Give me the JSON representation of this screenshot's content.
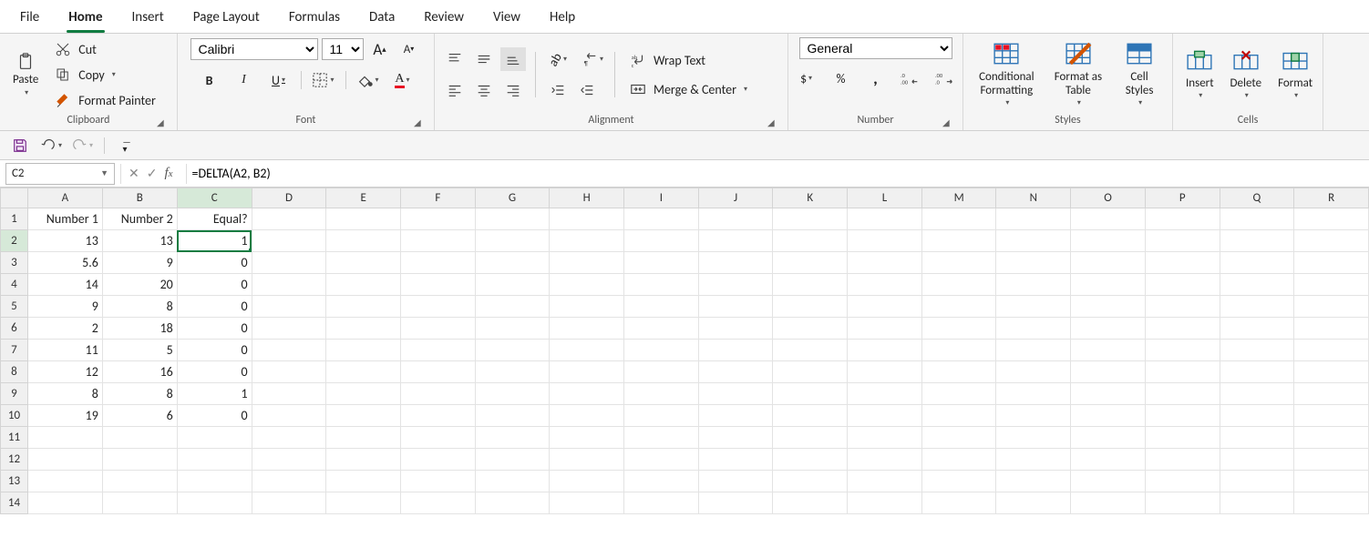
{
  "tabs": [
    "File",
    "Home",
    "Insert",
    "Page Layout",
    "Formulas",
    "Data",
    "Review",
    "View",
    "Help"
  ],
  "active_tab": "Home",
  "ribbon": {
    "clipboard": {
      "label": "Clipboard",
      "paste": "Paste",
      "cut": "Cut",
      "copy": "Copy",
      "painter": "Format Painter"
    },
    "font": {
      "label": "Font",
      "name": "Calibri",
      "size": "11",
      "grow": "A",
      "shrink": "A"
    },
    "alignment": {
      "label": "Alignment",
      "wrap": "Wrap Text",
      "merge": "Merge & Center"
    },
    "number": {
      "label": "Number",
      "format": "General"
    },
    "styles": {
      "label": "Styles",
      "cond": "Conditional Formatting",
      "table": "Format as Table",
      "cell": "Cell Styles"
    },
    "cells": {
      "label": "Cells",
      "insert": "Insert",
      "delete": "Delete",
      "format": "Format"
    }
  },
  "namebox": "C2",
  "formula": "=DELTA(A2, B2)",
  "columns": [
    "A",
    "B",
    "C",
    "D",
    "E",
    "F",
    "G",
    "H",
    "I",
    "J",
    "K",
    "L",
    "M",
    "N",
    "O",
    "P",
    "Q",
    "R"
  ],
  "row_count": 14,
  "headers": [
    "Number 1",
    "Number 2",
    "Equal?"
  ],
  "data": [
    [
      "13",
      "13",
      "1"
    ],
    [
      "5.6",
      "9",
      "0"
    ],
    [
      "14",
      "20",
      "0"
    ],
    [
      "9",
      "8",
      "0"
    ],
    [
      "2",
      "18",
      "0"
    ],
    [
      "11",
      "5",
      "0"
    ],
    [
      "12",
      "16",
      "0"
    ],
    [
      "8",
      "8",
      "1"
    ],
    [
      "19",
      "6",
      "0"
    ]
  ],
  "selected": {
    "row": 2,
    "col": "C"
  }
}
